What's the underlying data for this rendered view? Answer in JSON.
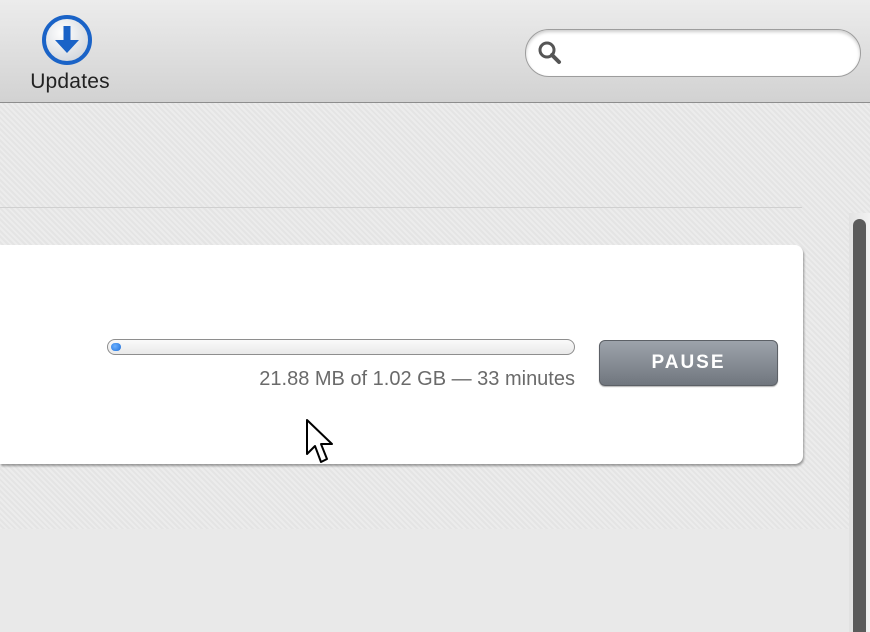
{
  "toolbar": {
    "updates_label": "Updates",
    "search": {
      "value": "",
      "placeholder": ""
    }
  },
  "download": {
    "progress_fraction": 0.021,
    "progress_text": "21.88 MB of 1.02 GB — 33 minutes",
    "pause_label": "PAUSE"
  },
  "icons": {
    "updates": "download-arrow-icon",
    "search": "magnifier-icon",
    "cursor": "arrow-cursor-icon"
  },
  "colors": {
    "accent": "#1f6fd8",
    "button": "#7e848c",
    "scroll_thumb": "#5b5b5b"
  }
}
